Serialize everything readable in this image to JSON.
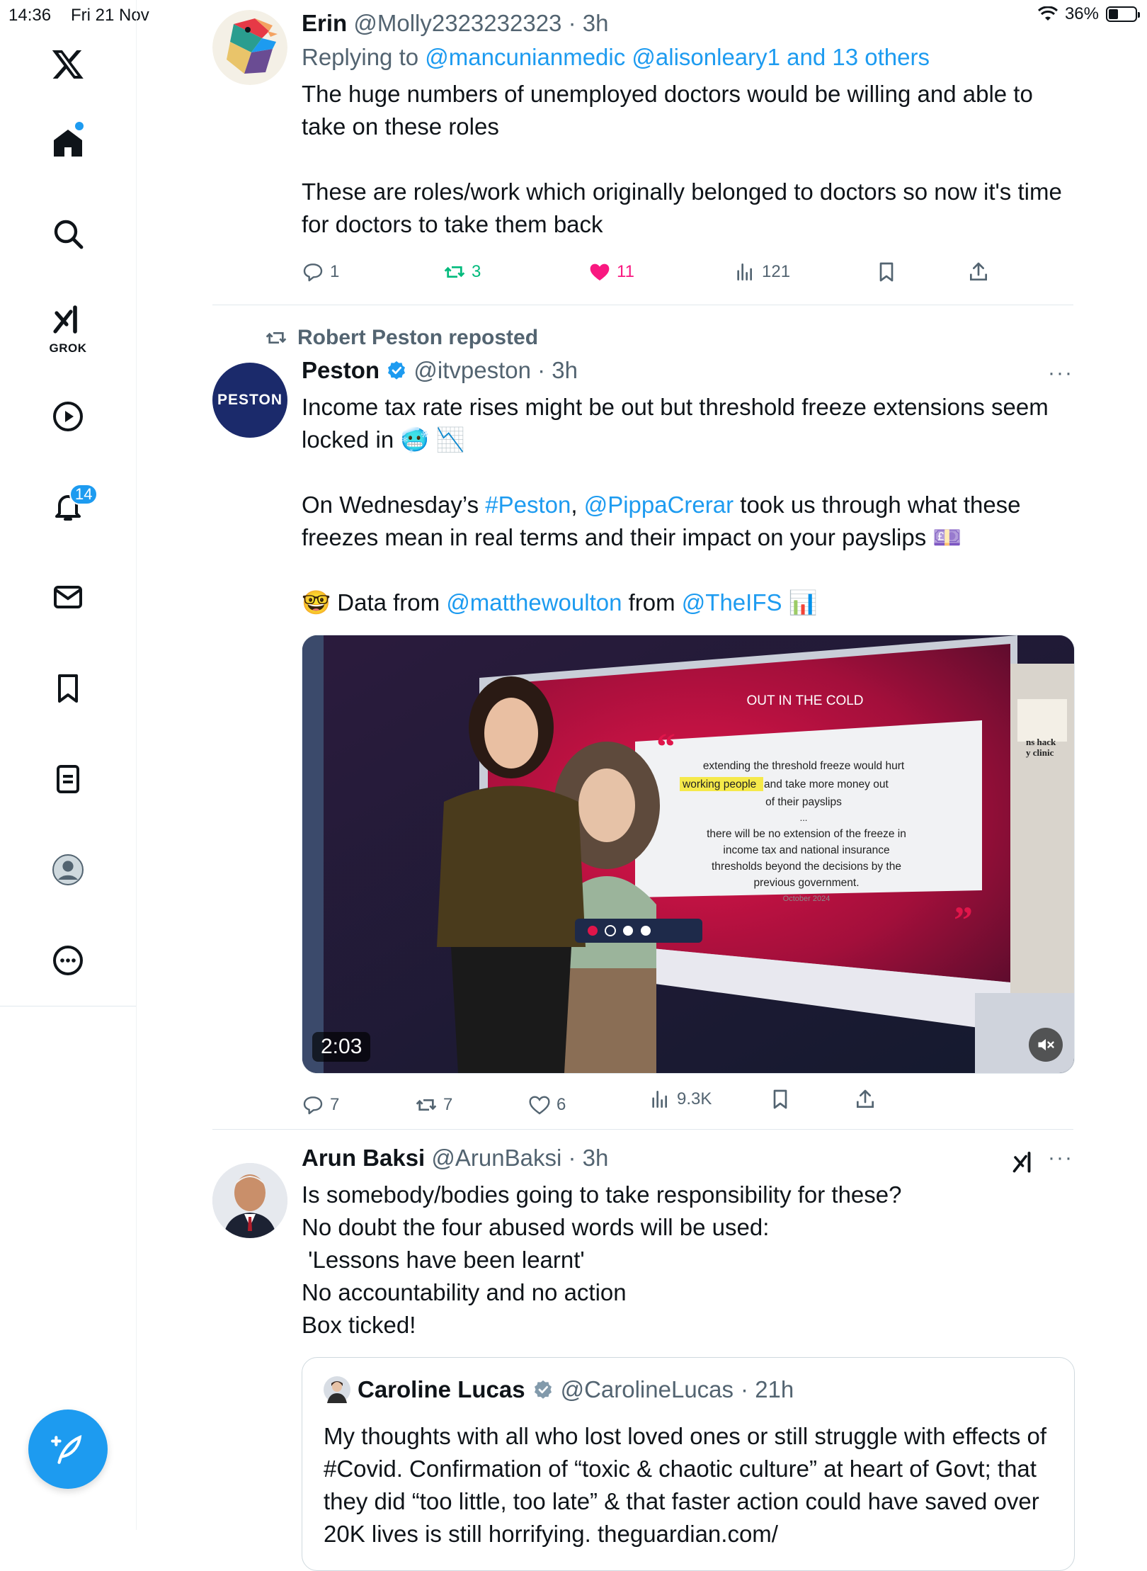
{
  "status_bar": {
    "time": "14:36",
    "date": "Fri 21 Nov",
    "battery": "36%",
    "battery_level": 0.36
  },
  "sidebar": {
    "notifications_count": "14",
    "grok_label": "GROK"
  },
  "tweets": [
    {
      "name": "Erin",
      "handle": "@Molly2323232323",
      "time": "· 3h",
      "replying_prefix": "Replying to ",
      "replying_to": "@mancunianmedic @alisonleary1 and 13 others",
      "text": "The huge numbers of unemployed doctors would be willing and able to take on these roles\n\nThese are roles/work which originally belonged to doctors so now it's time for doctors to take them back",
      "replies": "1",
      "reposts": "3",
      "likes": "11",
      "views": "121"
    },
    {
      "repost_label": "Robert Peston reposted",
      "name": "Peston",
      "handle": "@itvpeston",
      "time": "· 3h",
      "avatar_text": "PESTON",
      "text_p1": "Income tax rate rises might be out but threshold freeze extensions seem locked in 🥶 📉",
      "text_p2a": "On Wednesday’s ",
      "text_p2_tag": "#Peston",
      "text_p2b": ", ",
      "text_p2_mention": "@PippaCrerar",
      "text_p2c": " took us through what these freezes mean in real terms and their impact on your payslips 💷",
      "text_p3a": "🤓 Data from ",
      "text_p3_mention1": "@matthewoulton",
      "text_p3b": " from ",
      "text_p3_mention2": "@TheIFS",
      "text_p3c": " 📊",
      "video": {
        "duration": "2:03",
        "screen_title": "OUT IN THE COLD",
        "quote_line1": "extending the threshold freeze would hurt",
        "quote_highlight": "working people",
        "quote_line2": " and take more money out",
        "quote_line3": "of their payslips",
        "quote_ellipsis": "...",
        "quote_line4": "there will be no extension of the freeze in",
        "quote_line5": "income tax and national insurance",
        "quote_line6": "thresholds beyond the decisions by the",
        "quote_line7": "previous government.",
        "quote_date": "October 2024",
        "side_text": "ns hack\ny clinic"
      },
      "replies": "7",
      "reposts": "7",
      "likes": "6",
      "views": "9.3K"
    },
    {
      "name": "Arun Baksi",
      "handle": "@ArunBaksi",
      "time": "· 3h",
      "text": "Is somebody/bodies going to take responsibility for these?\nNo doubt the four abused words will be used:\n 'Lessons have been learnt'\nNo accountability and no action\nBox ticked!",
      "quoted": {
        "name": "Caroline Lucas",
        "handle": "@CarolineLucas",
        "time": "· 21h",
        "text": "My thoughts with all who lost loved ones or still struggle with effects of #Covid.  Confirmation of “toxic & chaotic culture” at heart of Govt; that they did “too little, too late” & that faster action could have saved over 20K lives is still horrifying. theguardian.com/"
      }
    }
  ],
  "colors": {
    "accent": "#1d9bf0",
    "like": "#f91880",
    "repost": "#00ba7c",
    "muted": "#536471"
  }
}
